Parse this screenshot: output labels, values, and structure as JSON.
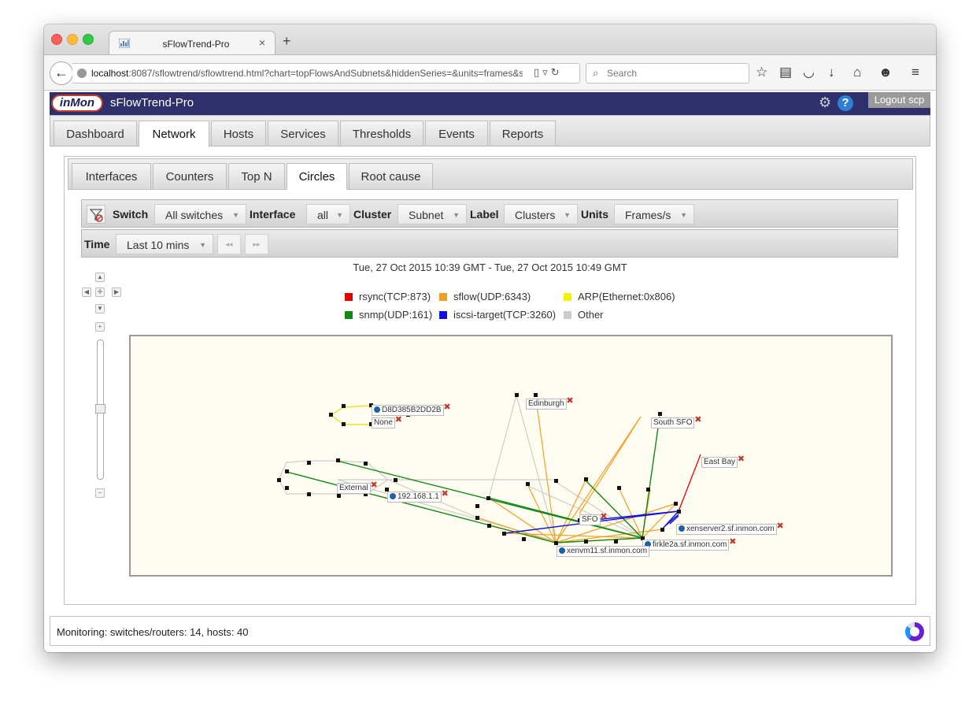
{
  "browser": {
    "tab_title": "sFlowTrend-Pro",
    "url_host": "localhost",
    "url_rest": ":8087/sflowtrend/sflowtrend.html?chart=topFlowsAndSubnets&hiddenSeries=&units=frames&sh",
    "search_placeholder": "Search"
  },
  "app": {
    "title": "sFlowTrend-Pro",
    "logo": "inMon",
    "logout_label": "Logout scp",
    "help_label": "?"
  },
  "main_tabs": [
    "Dashboard",
    "Network",
    "Hosts",
    "Services",
    "Thresholds",
    "Events",
    "Reports"
  ],
  "sub_tabs": [
    "Interfaces",
    "Counters",
    "Top N",
    "Circles",
    "Root cause"
  ],
  "controls": {
    "switch_label": "Switch",
    "switch_value": "All switches",
    "interface_label": "Interface",
    "interface_value": "all",
    "cluster_label": "Cluster",
    "cluster_value": "Subnet",
    "label_label": "Label",
    "label_value": "Clusters",
    "units_label": "Units",
    "units_value": "Frames/s",
    "time_label": "Time",
    "time_value": "Last 10 mins",
    "prev_label": "◂◂",
    "next_label": "▸▸"
  },
  "time_range": "Tue, 27 Oct 2015 10:39 GMT - Tue, 27 Oct 2015 10:49 GMT",
  "legend": [
    {
      "label": "rsync(TCP:873)",
      "color": "#e00000"
    },
    {
      "label": "sflow(UDP:6343)",
      "color": "#f0a020"
    },
    {
      "label": "ARP(Ethernet:0x806)",
      "color": "#f4f400"
    },
    {
      "label": "snmp(UDP:161)",
      "color": "#138a13"
    },
    {
      "label": "iscsi-target(TCP:3260)",
      "color": "#1010e0"
    },
    {
      "label": "Other",
      "color": "#cccccc"
    }
  ],
  "nodes": {
    "d8d": "D8D385B2DD2B",
    "none": "None",
    "edinburgh": "Edinburgh",
    "south_sfo": "South SFO",
    "east_bay": "East Bay",
    "external": "External",
    "ip": "192.168.1.1",
    "sfo": "SFO",
    "xenserver2": "xenserver2.sf.inmon.com",
    "firkle": "firkle2a.sf.inmon.com",
    "xenvm": "xenvm11.sf.inmon.com"
  },
  "status_text": "Monitoring: switches/routers: 14, hosts: 40"
}
